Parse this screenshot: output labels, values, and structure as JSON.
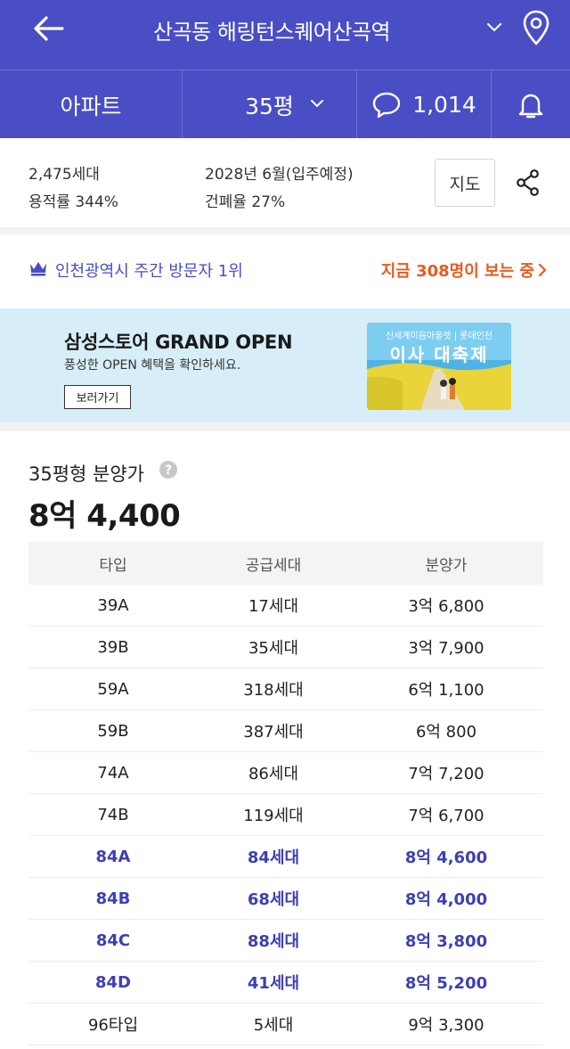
{
  "header": {
    "back_icon": "back-arrow-icon",
    "title": "산곡동 해링턴스퀘어산곡역",
    "location_icon": "map-pin-icon",
    "bg_color": "#4a4ec4"
  },
  "tabs": {
    "type_label": "아파트",
    "size_label": "35평",
    "talk_count": "1,014",
    "bell_icon": "bell-icon"
  },
  "info": {
    "households": "2,475세대",
    "move_in": "2028년 6월(입주예정)",
    "floor_area_ratio": "용적률 344%",
    "building_coverage": "건폐율 27%",
    "map_button": "지도",
    "share_icon": "share-icon"
  },
  "visitor": {
    "rank_text": "인천광역시 주간 방문자 1위",
    "now_viewing": "지금 308명이 보는 중",
    "accent_color": "#e85b1f"
  },
  "banner": {
    "title": "삼성스토어 GRAND OPEN",
    "subtitle": "풍성한 OPEN 혜택을 확인하세요.",
    "button": "보러가기",
    "image_caption": "신세계이음아울렛 | 롯데인천",
    "image_title": "이사 대축제"
  },
  "price": {
    "label": "35평형 분양가",
    "value": "8억 4,400"
  },
  "table": {
    "headers": [
      "타입",
      "공급세대",
      "분양가"
    ],
    "rows": [
      {
        "type": "39A",
        "supply": "17세대",
        "price": "3억 6,800",
        "highlight": false
      },
      {
        "type": "39B",
        "supply": "35세대",
        "price": "3억 7,900",
        "highlight": false
      },
      {
        "type": "59A",
        "supply": "318세대",
        "price": "6억 1,100",
        "highlight": false
      },
      {
        "type": "59B",
        "supply": "387세대",
        "price": "6억 800",
        "highlight": false
      },
      {
        "type": "74A",
        "supply": "86세대",
        "price": "7억 7,200",
        "highlight": false
      },
      {
        "type": "74B",
        "supply": "119세대",
        "price": "7억 6,700",
        "highlight": false
      },
      {
        "type": "84A",
        "supply": "84세대",
        "price": "8억 4,600",
        "highlight": true
      },
      {
        "type": "84B",
        "supply": "68세대",
        "price": "8억 4,000",
        "highlight": true
      },
      {
        "type": "84C",
        "supply": "88세대",
        "price": "8억 3,800",
        "highlight": true
      },
      {
        "type": "84D",
        "supply": "41세대",
        "price": "8억 5,200",
        "highlight": true
      },
      {
        "type": "96타입",
        "supply": "5세대",
        "price": "9억 3,300",
        "highlight": false
      }
    ],
    "highlight_color": "#3d3fb5"
  }
}
